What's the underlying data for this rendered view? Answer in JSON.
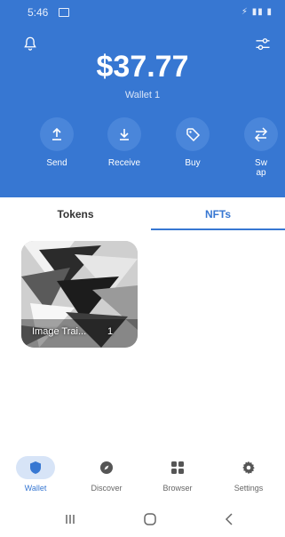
{
  "status_bar": {
    "time": "5:46",
    "right_icons": "⚡ ▮▮ ▮"
  },
  "header": {
    "balance": "$37.77",
    "wallet_name": "Wallet 1",
    "bell_icon": "bell-icon",
    "settings_icon": "filters-icon"
  },
  "actions": [
    {
      "label": "Send",
      "icon": "upload-icon"
    },
    {
      "label": "Receive",
      "icon": "download-icon"
    },
    {
      "label": "Buy",
      "icon": "tag-icon"
    },
    {
      "label": "Sw\nap",
      "icon": "swap-icon"
    }
  ],
  "tabs": {
    "tokens": "Tokens",
    "nfts": "NFTs",
    "active": "nfts"
  },
  "nft": {
    "caption": "Image Trai...",
    "count": "1"
  },
  "bottom_nav": [
    {
      "label": "Wallet",
      "icon": "shield-icon",
      "active": true
    },
    {
      "label": "Discover",
      "icon": "compass-icon",
      "active": false
    },
    {
      "label": "Browser",
      "icon": "grid-icon",
      "active": false
    },
    {
      "label": "Settings",
      "icon": "gear-icon",
      "active": false
    }
  ],
  "colors": {
    "brand": "#3777d2",
    "action_circle": "#4a86da",
    "active_nav_bg": "#d7e4f7"
  }
}
